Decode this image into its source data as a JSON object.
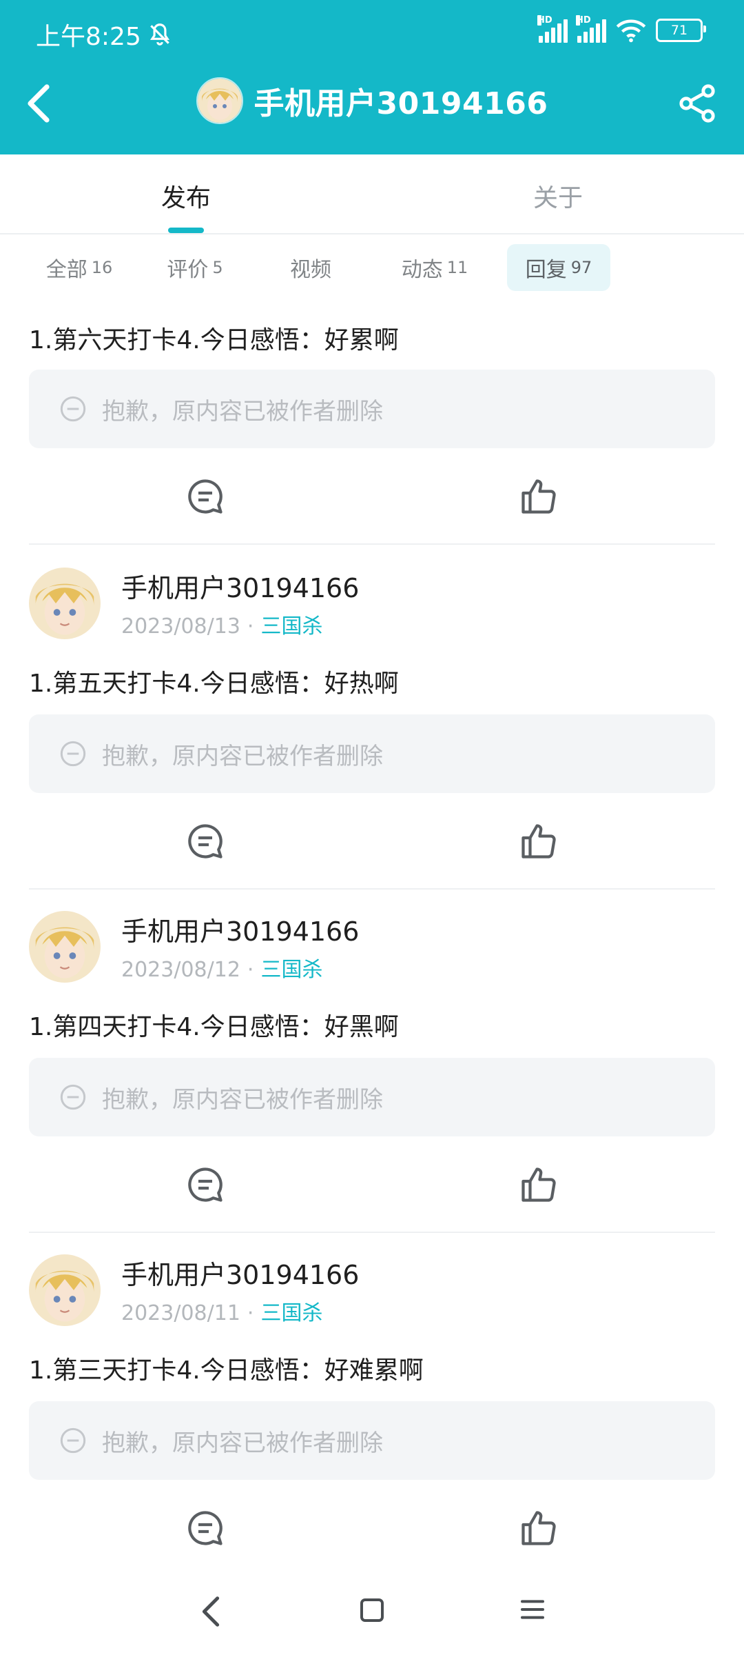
{
  "status_bar": {
    "time": "上午8:25",
    "hd1": "HD",
    "hd2": "HD",
    "battery": "71"
  },
  "header": {
    "title": "手机用户30194166"
  },
  "tabs": [
    {
      "label": "发布"
    },
    {
      "label": "关于"
    }
  ],
  "filters": [
    {
      "label": "全部",
      "count": "16"
    },
    {
      "label": "评价",
      "count": "5"
    },
    {
      "label": "视频",
      "count": ""
    },
    {
      "label": "动态",
      "count": "11"
    },
    {
      "label": "回复",
      "count": "97"
    }
  ],
  "posts": [
    {
      "username": "",
      "date": "",
      "game": "",
      "text": "1.第六天打卡4.今日感悟：好累啊",
      "deleted_text": "抱歉，原内容已被作者删除"
    },
    {
      "username": "手机用户30194166",
      "date": "2023/08/13",
      "game": "三国杀",
      "text": "1.第五天打卡4.今日感悟：好热啊",
      "deleted_text": "抱歉，原内容已被作者删除"
    },
    {
      "username": "手机用户30194166",
      "date": "2023/08/12",
      "game": "三国杀",
      "text": "1.第四天打卡4.今日感悟：好黑啊",
      "deleted_text": "抱歉，原内容已被作者删除"
    },
    {
      "username": "手机用户30194166",
      "date": "2023/08/11",
      "game": "三国杀",
      "text": "1.第三天打卡4.今日感悟：好难累啊",
      "deleted_text": "抱歉，原内容已被作者删除"
    }
  ],
  "separator": "·",
  "colors": {
    "accent": "#14b8c8",
    "header_bg": "#14b8c8",
    "chip_active_bg": "#e6f6f9"
  }
}
